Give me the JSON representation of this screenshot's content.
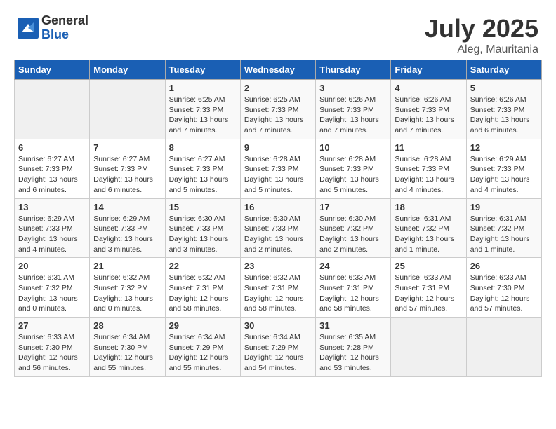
{
  "header": {
    "logo_general": "General",
    "logo_blue": "Blue",
    "month": "July 2025",
    "location": "Aleg, Mauritania"
  },
  "weekdays": [
    "Sunday",
    "Monday",
    "Tuesday",
    "Wednesday",
    "Thursday",
    "Friday",
    "Saturday"
  ],
  "weeks": [
    [
      {
        "day": "",
        "info": ""
      },
      {
        "day": "",
        "info": ""
      },
      {
        "day": "1",
        "info": "Sunrise: 6:25 AM\nSunset: 7:33 PM\nDaylight: 13 hours and 7 minutes."
      },
      {
        "day": "2",
        "info": "Sunrise: 6:25 AM\nSunset: 7:33 PM\nDaylight: 13 hours and 7 minutes."
      },
      {
        "day": "3",
        "info": "Sunrise: 6:26 AM\nSunset: 7:33 PM\nDaylight: 13 hours and 7 minutes."
      },
      {
        "day": "4",
        "info": "Sunrise: 6:26 AM\nSunset: 7:33 PM\nDaylight: 13 hours and 7 minutes."
      },
      {
        "day": "5",
        "info": "Sunrise: 6:26 AM\nSunset: 7:33 PM\nDaylight: 13 hours and 6 minutes."
      }
    ],
    [
      {
        "day": "6",
        "info": "Sunrise: 6:27 AM\nSunset: 7:33 PM\nDaylight: 13 hours and 6 minutes."
      },
      {
        "day": "7",
        "info": "Sunrise: 6:27 AM\nSunset: 7:33 PM\nDaylight: 13 hours and 6 minutes."
      },
      {
        "day": "8",
        "info": "Sunrise: 6:27 AM\nSunset: 7:33 PM\nDaylight: 13 hours and 5 minutes."
      },
      {
        "day": "9",
        "info": "Sunrise: 6:28 AM\nSunset: 7:33 PM\nDaylight: 13 hours and 5 minutes."
      },
      {
        "day": "10",
        "info": "Sunrise: 6:28 AM\nSunset: 7:33 PM\nDaylight: 13 hours and 5 minutes."
      },
      {
        "day": "11",
        "info": "Sunrise: 6:28 AM\nSunset: 7:33 PM\nDaylight: 13 hours and 4 minutes."
      },
      {
        "day": "12",
        "info": "Sunrise: 6:29 AM\nSunset: 7:33 PM\nDaylight: 13 hours and 4 minutes."
      }
    ],
    [
      {
        "day": "13",
        "info": "Sunrise: 6:29 AM\nSunset: 7:33 PM\nDaylight: 13 hours and 4 minutes."
      },
      {
        "day": "14",
        "info": "Sunrise: 6:29 AM\nSunset: 7:33 PM\nDaylight: 13 hours and 3 minutes."
      },
      {
        "day": "15",
        "info": "Sunrise: 6:30 AM\nSunset: 7:33 PM\nDaylight: 13 hours and 3 minutes."
      },
      {
        "day": "16",
        "info": "Sunrise: 6:30 AM\nSunset: 7:33 PM\nDaylight: 13 hours and 2 minutes."
      },
      {
        "day": "17",
        "info": "Sunrise: 6:30 AM\nSunset: 7:32 PM\nDaylight: 13 hours and 2 minutes."
      },
      {
        "day": "18",
        "info": "Sunrise: 6:31 AM\nSunset: 7:32 PM\nDaylight: 13 hours and 1 minute."
      },
      {
        "day": "19",
        "info": "Sunrise: 6:31 AM\nSunset: 7:32 PM\nDaylight: 13 hours and 1 minute."
      }
    ],
    [
      {
        "day": "20",
        "info": "Sunrise: 6:31 AM\nSunset: 7:32 PM\nDaylight: 13 hours and 0 minutes."
      },
      {
        "day": "21",
        "info": "Sunrise: 6:32 AM\nSunset: 7:32 PM\nDaylight: 13 hours and 0 minutes."
      },
      {
        "day": "22",
        "info": "Sunrise: 6:32 AM\nSunset: 7:31 PM\nDaylight: 12 hours and 58 minutes."
      },
      {
        "day": "23",
        "info": "Sunrise: 6:32 AM\nSunset: 7:31 PM\nDaylight: 12 hours and 58 minutes."
      },
      {
        "day": "24",
        "info": "Sunrise: 6:33 AM\nSunset: 7:31 PM\nDaylight: 12 hours and 58 minutes."
      },
      {
        "day": "25",
        "info": "Sunrise: 6:33 AM\nSunset: 7:31 PM\nDaylight: 12 hours and 57 minutes."
      },
      {
        "day": "26",
        "info": "Sunrise: 6:33 AM\nSunset: 7:30 PM\nDaylight: 12 hours and 57 minutes."
      }
    ],
    [
      {
        "day": "27",
        "info": "Sunrise: 6:33 AM\nSunset: 7:30 PM\nDaylight: 12 hours and 56 minutes."
      },
      {
        "day": "28",
        "info": "Sunrise: 6:34 AM\nSunset: 7:30 PM\nDaylight: 12 hours and 55 minutes."
      },
      {
        "day": "29",
        "info": "Sunrise: 6:34 AM\nSunset: 7:29 PM\nDaylight: 12 hours and 55 minutes."
      },
      {
        "day": "30",
        "info": "Sunrise: 6:34 AM\nSunset: 7:29 PM\nDaylight: 12 hours and 54 minutes."
      },
      {
        "day": "31",
        "info": "Sunrise: 6:35 AM\nSunset: 7:28 PM\nDaylight: 12 hours and 53 minutes."
      },
      {
        "day": "",
        "info": ""
      },
      {
        "day": "",
        "info": ""
      }
    ]
  ]
}
